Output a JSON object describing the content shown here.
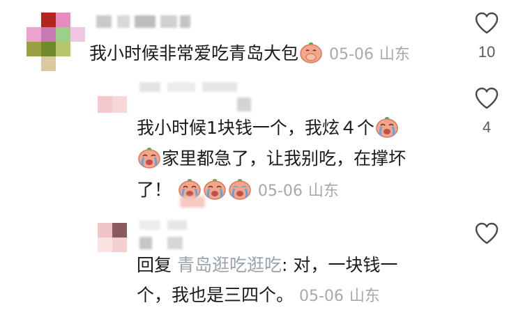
{
  "colors": {
    "text": "#1a1a1a",
    "meta": "#a8a8a8",
    "reply_name": "#9aa3ad",
    "heart_outline": "#4a4a4a",
    "emoji_face": "#f4a58a",
    "emoji_tear": "#5aa9e6",
    "emoji_leaf": "#47b04b"
  },
  "comments": [
    {
      "text": "我小时候非常爱吃青岛大包",
      "emoji": "cover-mouth-bun-emoji",
      "time": "05-06",
      "location": "山东",
      "likes": "10"
    },
    {
      "line1": "我小时候1块钱一个，我炫４个",
      "line2": "家里都急了，让我别吃，在撑坏",
      "line3": "了！",
      "emoji": "crying-bun-emoji",
      "time": "05-06",
      "location": "山东",
      "likes": "4"
    },
    {
      "reply_prefix": "回复",
      "reply_to": "青岛逛吃逛吃",
      "line1_rest": ": 对，一块钱一",
      "line2": "个，我也是三四个。",
      "time": "05-06",
      "location": "山东",
      "likes": ""
    }
  ],
  "icons": {
    "like": "heart-outline-icon"
  }
}
